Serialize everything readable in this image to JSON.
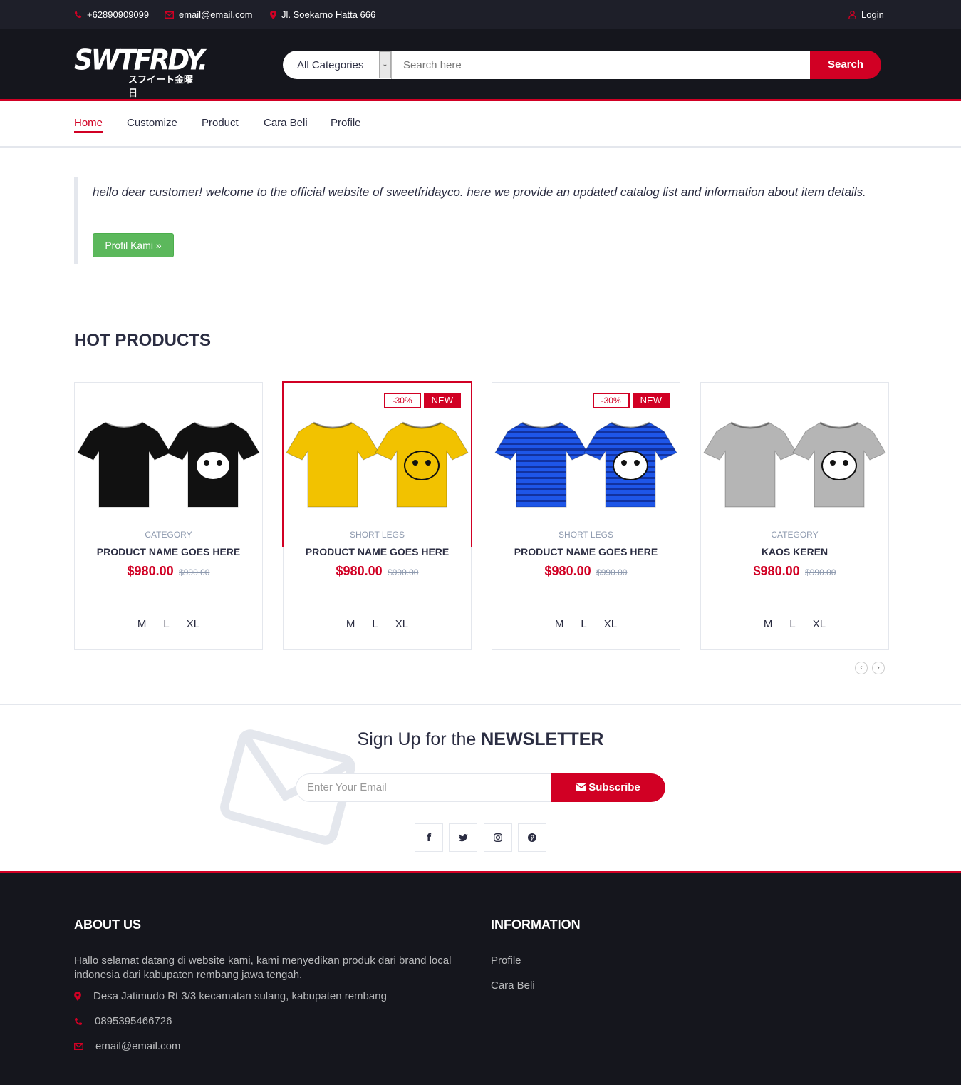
{
  "topbar": {
    "phone": "+62890909099",
    "email": "email@email.com",
    "address": "Jl. Soekarno Hatta 666",
    "login": "Login"
  },
  "logo": {
    "text": "SWTFRDY.",
    "subtext": "スフイート金曜日"
  },
  "search": {
    "category": "All Categories",
    "placeholder": "Search here",
    "button": "Search"
  },
  "nav": {
    "items": [
      "Home",
      "Customize",
      "Product",
      "Cara Beli",
      "Profile"
    ],
    "active": "Home"
  },
  "intro": {
    "text": "hello dear customer! welcome to the official website of sweetfridayco. here we provide an updated catalog list and information about item details.",
    "button": "Profil Kami »"
  },
  "hot_products": {
    "title": "HOT PRODUCTS",
    "products": [
      {
        "category": "CATEGORY",
        "name": "PRODUCT NAME GOES HERE",
        "price": "$980.00",
        "old_price": "$990.00",
        "sale": "",
        "new": "",
        "sizes": [
          "M",
          "L",
          "XL"
        ],
        "shirt_color": "#111111"
      },
      {
        "category": "SHORT LEGS",
        "name": "PRODUCT NAME GOES HERE",
        "price": "$980.00",
        "old_price": "$990.00",
        "sale": "-30%",
        "new": "NEW",
        "sizes": [
          "M",
          "L",
          "XL"
        ],
        "shirt_color": "#f2c200"
      },
      {
        "category": "SHORT LEGS",
        "name": "PRODUCT NAME GOES HERE",
        "price": "$980.00",
        "old_price": "$990.00",
        "sale": "-30%",
        "new": "NEW",
        "sizes": [
          "M",
          "L",
          "XL"
        ],
        "shirt_color": "#1e56e8"
      },
      {
        "category": "CATEGORY",
        "name": "KAOS KEREN",
        "price": "$980.00",
        "old_price": "$990.00",
        "sale": "",
        "new": "",
        "sizes": [
          "M",
          "L",
          "XL"
        ],
        "shirt_color": "#b5b5b5"
      }
    ]
  },
  "newsletter": {
    "title_prefix": "Sign Up for the ",
    "title_bold": "NEWSLETTER",
    "placeholder": "Enter Your Email",
    "button": "Subscribe",
    "social": [
      "facebook-icon",
      "twitter-icon",
      "instagram-icon",
      "pinterest-icon"
    ]
  },
  "footer": {
    "about_title": "ABOUT US",
    "about_text": "Hallo selamat datang di website kami, kami menyedikan produk dari brand local indonesia dari kabupaten rembang jawa tengah.",
    "address": "Desa Jatimudo Rt 3/3 kecamatan sulang, kabupaten rembang",
    "phone": "0895395466726",
    "email": "email@email.com",
    "info_title": "INFORMATION",
    "info_links": [
      "Profile",
      "Cara Beli"
    ]
  },
  "colors": {
    "accent": "#d10024",
    "dark": "#15161d",
    "topbar": "#1e1f29",
    "green": "#5cb85c"
  }
}
